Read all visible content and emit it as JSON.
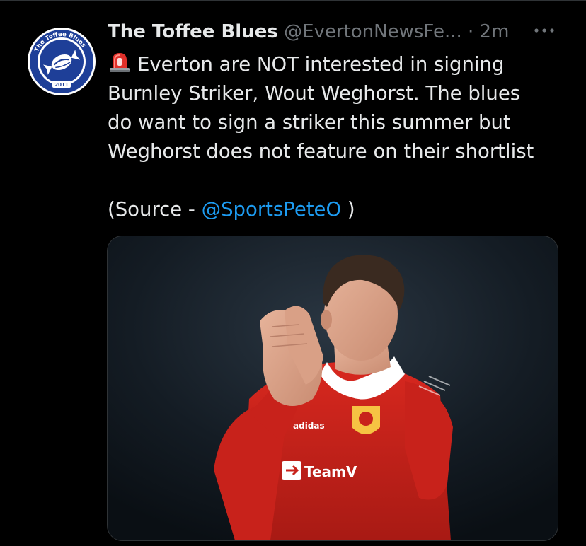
{
  "tweet": {
    "display_name": "The Toffee Blues",
    "handle": "@EvertonNewsFe...",
    "separator": "·",
    "time": "2m",
    "text_lines": [
      "Everton are NOT interested in signing",
      "Burnley Striker, Wout Weghorst. The blues",
      "do want to sign a striker this summer but",
      "Weghorst does not feature on their shortlist"
    ],
    "source_prefix": "(Source - ",
    "source_mention": "@SportsPeteO",
    "source_suffix": " )",
    "leading_icon": "siren-emoji-icon",
    "more_icon": "more-options-icon"
  },
  "avatar": {
    "ring_text": "The Toffee Blues",
    "year": "2011",
    "bg_color": "#1e3f98",
    "ring_color": "#ffffff"
  },
  "media": {
    "alt": "Footballer in red Manchester United kit applauding",
    "sponsor": "TeamViewer",
    "kit_brand": "adidas",
    "kit_color": "#d0261e"
  },
  "colors": {
    "background": "#000000",
    "text": "#e7e9ea",
    "muted": "#71767b",
    "link": "#1d9bf0",
    "border": "#2f3336"
  }
}
